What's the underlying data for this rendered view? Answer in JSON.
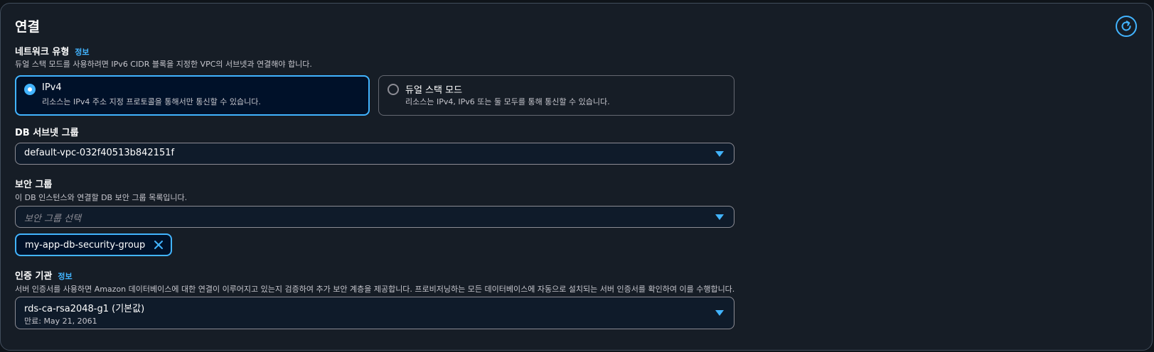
{
  "section": {
    "title": "연결"
  },
  "icons": {
    "refresh": "refresh-icon",
    "caret": "caret-down-icon",
    "dismiss": "close-icon"
  },
  "colors": {
    "accent": "#42b4ff",
    "panel_bg": "#161d26",
    "text": "#ffffff"
  },
  "network_type": {
    "label": "네트워크 유형",
    "info": "정보",
    "description": "듀얼 스택 모드를 사용하려면 IPv6 CIDR 블록을 지정한 VPC의 서브넷과 연결해야 합니다.",
    "options": [
      {
        "title": "IPv4",
        "description": "리소스는 IPv4 주소 지정 프로토콜을 통해서만 통신할 수 있습니다.",
        "selected": true
      },
      {
        "title": "듀얼 스택 모드",
        "description": "리소스는 IPv4, IPv6 또는 둘 모두를 통해 통신할 수 있습니다.",
        "selected": false
      }
    ]
  },
  "subnet_group": {
    "label": "DB 서브넷 그룹",
    "value": "default-vpc-032f40513b842151f"
  },
  "security_group": {
    "label": "보안 그룹",
    "description": "이 DB 인스턴스와 연결할 DB 보안 그룹 목록입니다.",
    "placeholder": "보안 그룹 선택",
    "tokens": [
      "my-app-db-security-group"
    ]
  },
  "certificate_authority": {
    "label": "인증 기관",
    "info": "정보",
    "description": "서버 인증서를 사용하면 Amazon 데이터베이스에 대한 연결이 이루어지고 있는지 검증하여 추가 보안 계층을 제공합니다. 프로비저닝하는 모든 데이터베이스에 자동으로 설치되는 서버 인증서를 확인하여 이를 수행합니다.",
    "value": "rds-ca-rsa2048-g1 (기본값)",
    "expiry": "만료: May 21, 2061"
  }
}
